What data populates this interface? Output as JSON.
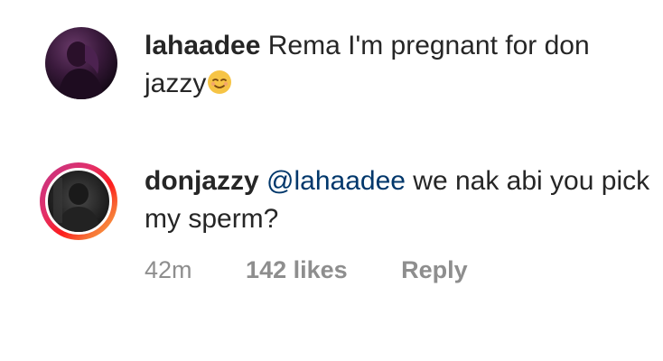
{
  "comments": [
    {
      "username": "lahaadee",
      "text": "Rema I'm pregnant for don jazzy",
      "emoji": "smiling-face-emoji"
    },
    {
      "username": "donjazzy",
      "mention": "@lahaadee",
      "text": "we nak abi you pick my sperm?",
      "time": "42m",
      "likes": "142 likes",
      "reply_label": "Reply"
    }
  ],
  "colors": {
    "text": "#262626",
    "meta": "#8e8e8e",
    "mention": "#00376b",
    "story_ring_start": "#c13584",
    "story_ring_end": "#fcaf45"
  }
}
